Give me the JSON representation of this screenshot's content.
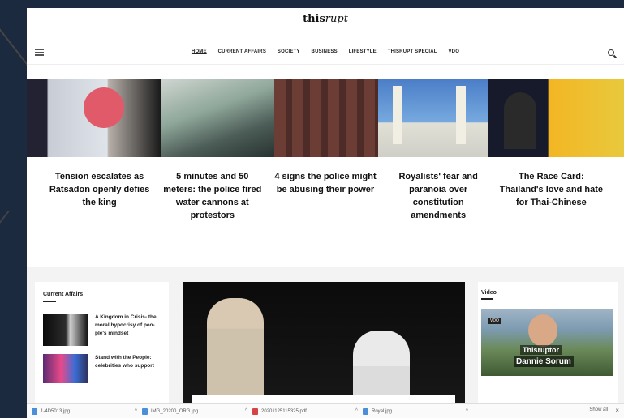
{
  "site": {
    "logo_main": "this",
    "logo_sub": "rupt"
  },
  "nav": {
    "items": [
      "HOME",
      "CURRENT AFFAIRS",
      "SOCIETY",
      "BUSINESS",
      "LIFESTYLE",
      "THISRUPT SPECIAL",
      "VDO"
    ]
  },
  "articles": [
    {
      "title": "Tension escalates as Ratsadon openly defies the king"
    },
    {
      "title": "5 minutes and 50 meters: the police fired water cannons at protestors"
    },
    {
      "title": "4 signs the police might be abusing their power"
    },
    {
      "title": "Royalists' fear and paranoia over constitution amendments"
    },
    {
      "title": "The Race Card: Thailand's love and hate for Thai-Chinese"
    }
  ],
  "sidebar": {
    "heading": "Current Affairs",
    "items": [
      {
        "title": "A Kingdom in Crisis- the moral hypocrisy of peo-ple's mindset"
      },
      {
        "title": "Stand with the People: celebrities who support"
      }
    ]
  },
  "video": {
    "heading": "Video",
    "tag": "VDO",
    "name_line1": "Thisruptor",
    "name_line2": "Dannie Sorum"
  },
  "downloads": {
    "items": [
      {
        "name": "1-4D5013.jpg",
        "type": "jpg"
      },
      {
        "name": "IMG_20200_ORG.jpg",
        "type": "jpg"
      },
      {
        "name": "20201125115325.pdf",
        "type": "pdf"
      },
      {
        "name": "Royal.jpg",
        "type": "jpg"
      }
    ],
    "show_all": "Show all"
  },
  "colors": {
    "background": "#1c2a3f",
    "page": "#ffffff",
    "text": "#111111"
  }
}
